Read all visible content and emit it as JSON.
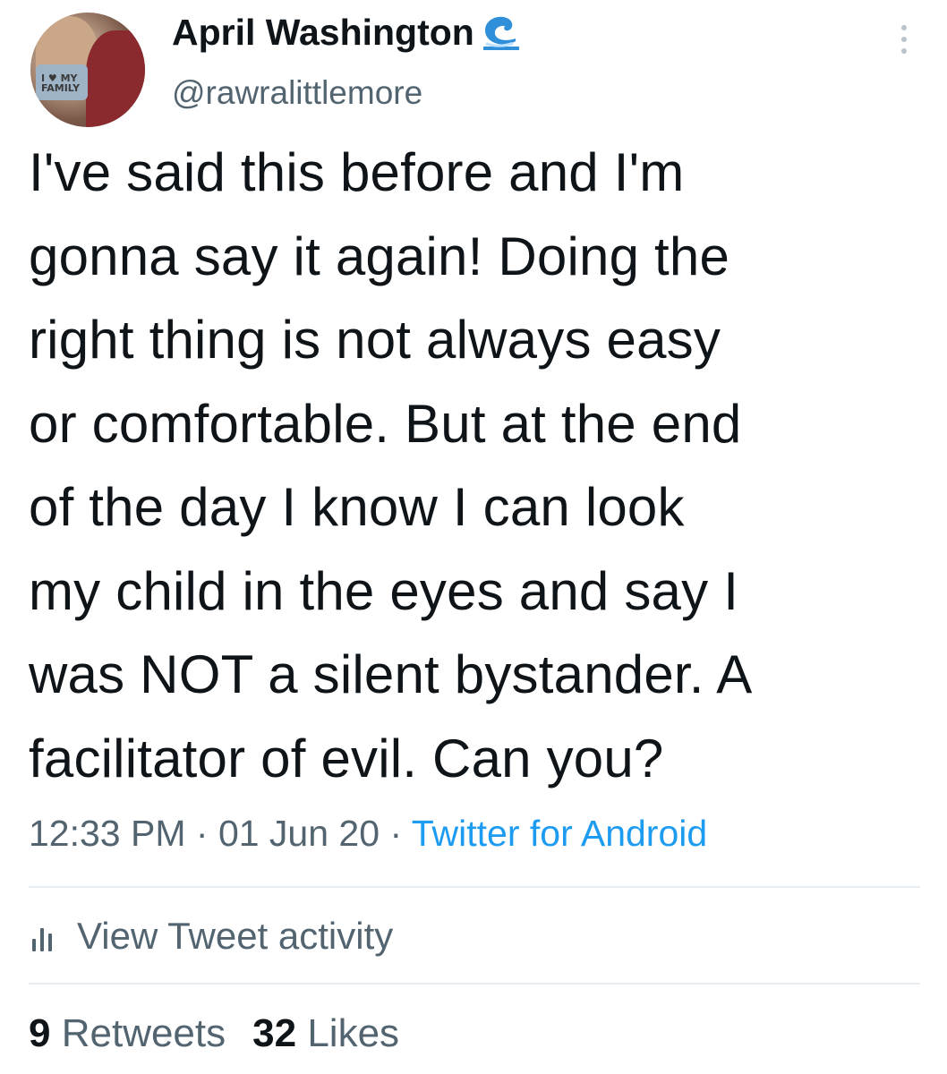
{
  "author": {
    "name": "April Washington",
    "handle": "@rawralittlemore",
    "avatar_shirt_text": "I ♥ MY FAMILY",
    "badge_icon": "wave-emoji-icon"
  },
  "menu_icon": "more-vertical-icon",
  "tweet": {
    "text": "I've said this before and I'm\ngonna say it again! Doing the\nright thing is not always easy\nor comfortable. But at the end\nof the day I know I can look\nmy child in the eyes and say I\nwas NOT a silent bystander. A\nfacilitator of evil. Can you?",
    "time": "12:33 PM",
    "date": "01 Jun 20",
    "source": "Twitter for Android",
    "separator": " · "
  },
  "activity": {
    "icon": "bar-chart-icon",
    "label": "View Tweet activity"
  },
  "stats": {
    "retweets_count": "9",
    "retweets_label": "Retweets",
    "likes_count": "32",
    "likes_label": "Likes"
  },
  "colors": {
    "text": "#0f1419",
    "secondary": "#536471",
    "link": "#1d9bf0",
    "divider": "#e6ecf0"
  }
}
